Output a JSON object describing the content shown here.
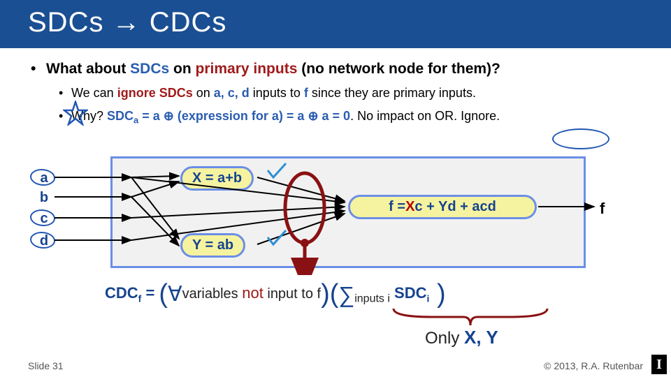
{
  "title": {
    "pre": "SDCs ",
    "arrow": "→",
    "post": " CDCs"
  },
  "bullets": {
    "main": {
      "pre": "What about ",
      "sdcs": "SDCs",
      "mid": " on ",
      "pi": "primary inputs",
      "post": " (no network node for them)?"
    },
    "sub1": {
      "pre": "We can ",
      "ignore": "ignore SDCs",
      "mid1": " on ",
      "vars": "a, c, d",
      "mid2": " inputs to ",
      "fvar": "f",
      "post": " since they are primary inputs."
    },
    "sub2": {
      "pre": "Why?   ",
      "sdca": "SDC",
      "sdcasub": "a",
      "eq": " = a ⊕ (expression for a) = a ⊕ a = 0",
      "post1": ".  No impact on OR.  ",
      "ignore": "Ignore."
    }
  },
  "inputs": {
    "a": "a",
    "b": "b",
    "c": "c",
    "d": "d"
  },
  "nodes": {
    "x": "X = a+b",
    "y": "Y = ab",
    "f_pre": "f =",
    "f_x": "X",
    "f_mid1": "c + ",
    "f_y": "Y",
    "f_mid2": "d + acd"
  },
  "out_f": "f",
  "cdc": {
    "label": "CDC",
    "sub_f": "f",
    "eq": " = ",
    "lp1": "(",
    "forall": "∀",
    "vars_text": "variables ",
    "not": "not",
    "input_to_f": " input to f",
    "rp1": ")",
    "lp2": "(",
    "sigma": "∑",
    "inputs_i": "inputs i",
    "sp": "   ",
    "sdc": "SDC",
    "sub_i": "i",
    "rp2": " )"
  },
  "only": {
    "pre": "Only ",
    "xy": "X, Y"
  },
  "footer": {
    "left": "Slide 31",
    "right": "© 2013, R.A. Rutenbar",
    "logo": "I"
  }
}
